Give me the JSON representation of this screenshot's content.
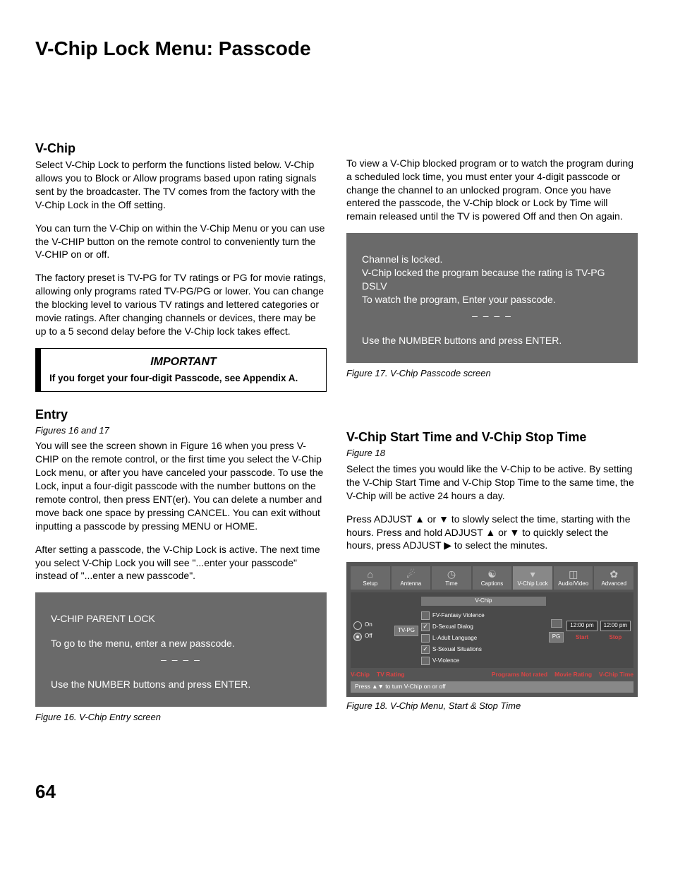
{
  "page_title": "V-Chip Lock Menu: Passcode",
  "page_number": "64",
  "left_col": {
    "vchip_heading": "V-Chip",
    "vchip_p1": "Select V-Chip Lock to perform the functions listed below. V-Chip allows you to Block or Allow programs based upon rating signals sent by the broadcaster.  The TV comes from the factory with the V-Chip Lock in the Off setting.",
    "vchip_p2": "You can turn the V-Chip on within the V-Chip Menu or you can use the V-CHIP button on the remote control to conveniently turn the V-CHIP on or off.",
    "vchip_p3": "The factory preset is TV-PG for TV ratings or PG for movie ratings, allowing only programs rated TV-PG/PG or lower.  You can change the blocking level to various TV ratings and lettered categories or movie ratings.  After changing channels or devices, there may be up to a 5 second delay before the V-Chip lock takes effect.",
    "important_title": "IMPORTANT",
    "important_body": "If you forget your four-digit Passcode, see Appendix A.",
    "entry_heading": "Entry",
    "entry_figref": "Figures 16 and 17",
    "entry_p1": "You will see the screen shown in Figure 16 when you press V-CHIP on the remote control, or the first time you select the V-Chip Lock menu, or after you have canceled your passcode.  To use the Lock, input a four-digit passcode with the number buttons on the remote control, then press ENT(er).  You can delete a number and move back one space by pressing CANCEL.  You can exit without inputting a passcode by pressing MENU or HOME.",
    "entry_p2": "After setting a passcode, the V-Chip Lock is active.  The next time you select V-Chip Lock you will see \"...enter your passcode\" instead of \"...enter a new passcode\".",
    "fig16": {
      "line1": "V-CHIP PARENT LOCK",
      "line2": "To go to the menu, enter a new passcode.",
      "dashes": "– – – –",
      "line3": "Use the NUMBER buttons and press ENTER."
    },
    "fig16_caption": "Figure 16. V-Chip Entry screen"
  },
  "right_col": {
    "top_p": "To view a V-Chip blocked program or to watch the program during a scheduled lock time, you must enter your 4-digit passcode or change the channel to an unlocked program.  Once you have entered the passcode, the V-Chip block or Lock by Time will remain released until the TV is powered Off and then On again.",
    "fig17": {
      "line1": "Channel is locked.",
      "line2": "V-Chip locked the program because the rating is TV-PG DSLV",
      "line3": "To watch the program, Enter your passcode.",
      "dashes": "– – – –",
      "line4": "Use the NUMBER buttons and press ENTER."
    },
    "fig17_caption": "Figure 17. V-Chip Passcode screen",
    "time_heading": "V-Chip Start Time and V-Chip Stop Time",
    "time_figref": "Figure 18",
    "time_p1": "Select the times you would like the V-Chip to be active.  By setting the V-Chip Start Time and V-Chip Stop Time to the same time, the V-Chip will be active 24 hours a day.",
    "time_p2a": "Press ADJUST ",
    "time_p2b": " or  ",
    "time_p2c": " to slowly select the time, starting with the hours.  Press and hold ADJUST ",
    "time_p2d": " or ",
    "time_p2e": " to quickly select the hours, press ADJUST ",
    "time_p2f": " to select the minutes.",
    "fig18_caption": "Figure 18. V-Chip Menu, Start & Stop Time",
    "menu": {
      "tabs": [
        "Setup",
        "Antenna",
        "Time",
        "Captions",
        "V-Chip Lock",
        "Audio/Video",
        "Advanced"
      ],
      "sub_header": "V-Chip",
      "on": "On",
      "off": "Off",
      "tvpg": "TV-PG",
      "rows": [
        {
          "label": "FV-Fantasy Violence",
          "checked": false
        },
        {
          "label": "D-Sexual Dialog",
          "checked": true
        },
        {
          "label": "L-Adult Language",
          "checked": false
        },
        {
          "label": "S-Sexual Situations",
          "checked": true
        },
        {
          "label": "V-Violence",
          "checked": false
        }
      ],
      "pg": "PG",
      "start_time": "12:00 pm",
      "stop_time": "12:00 pm",
      "start_label": "Start",
      "stop_label": "Stop",
      "bottom": [
        "V-Chip",
        "TV Rating",
        "Programs Not rated",
        "Movie Rating",
        "V-Chip Time"
      ],
      "hint": "Press ▲▼ to turn V-Chip on or off"
    }
  }
}
